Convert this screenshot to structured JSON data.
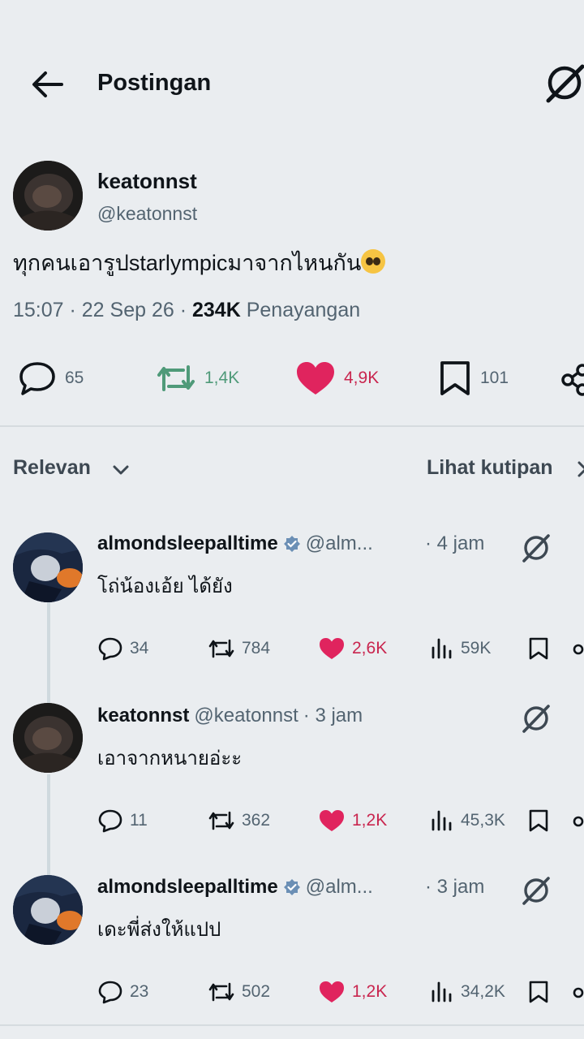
{
  "header": {
    "title": "Postingan"
  },
  "post": {
    "name": "keatonnst",
    "handle": "@keatonnst",
    "text": "ทุกคนเอารูปstarlympicมาจากไหนกัน",
    "time": "15:07",
    "date": "22 Sep 26",
    "views_count": "234K",
    "views_label": "Penayangan",
    "replies": "65",
    "reposts": "1,4K",
    "likes": "4,9K",
    "bookmarks": "101"
  },
  "sort": {
    "label": "Relevan",
    "quotes_label": "Lihat kutipan"
  },
  "replies": [
    {
      "name": "almondsleepalltime",
      "handle": "@alm...",
      "verified": true,
      "time": "· 4 jam",
      "text": "โถ่น้องเอ้ย ได้ยัง",
      "replies": "34",
      "reposts": "784",
      "likes": "2,6K",
      "views": "59K"
    },
    {
      "name": "keatonnst",
      "handle": "@keatonnst",
      "verified": false,
      "time": "· 3 jam",
      "text": "เอาจากหนายอ่ะะ",
      "replies": "11",
      "reposts": "362",
      "likes": "1,2K",
      "views": "45,3K"
    },
    {
      "name": "almondsleepalltime",
      "handle": "@alm...",
      "verified": true,
      "time": "· 3 jam",
      "text": "เดะพี่ส่งให้แปป",
      "replies": "23",
      "reposts": "502",
      "likes": "1,2K",
      "views": "34,2K"
    }
  ],
  "colors": {
    "like": "#c9264f",
    "repost": "#4f9a79",
    "verified": "#6b8fb5",
    "background": "#eaedf0"
  }
}
